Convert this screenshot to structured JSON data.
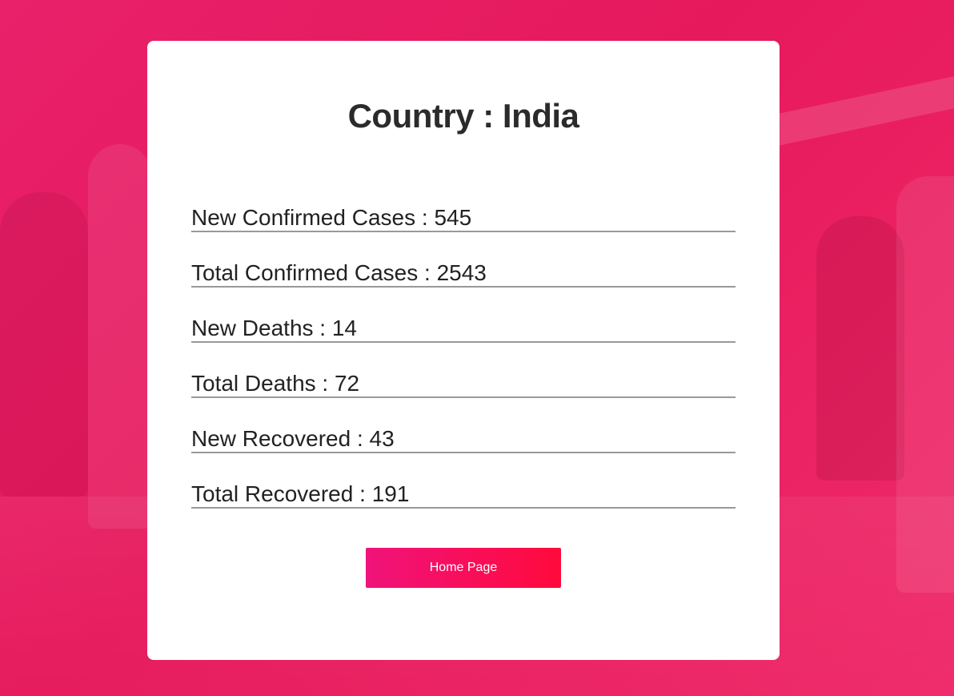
{
  "header": {
    "label": "Country",
    "separator": " : ",
    "country": "India"
  },
  "stats": [
    {
      "label": "New Confirmed Cases",
      "value": "545"
    },
    {
      "label": "Total Confirmed Cases",
      "value": "2543"
    },
    {
      "label": "New Deaths",
      "value": "14"
    },
    {
      "label": "Total Deaths",
      "value": "72"
    },
    {
      "label": "New Recovered",
      "value": "43"
    },
    {
      "label": "Total Recovered",
      "value": "191"
    }
  ],
  "stat_separator": " : ",
  "actions": {
    "home_label": "Home Page"
  },
  "colors": {
    "background_accent": "#e6195c",
    "button_gradient_start": "#f0137b",
    "button_gradient_end": "#ff0a3c",
    "title_text": "#2b2b2b"
  }
}
